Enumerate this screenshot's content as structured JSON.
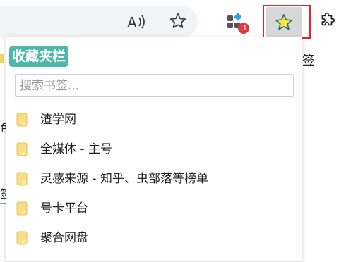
{
  "toolbar": {
    "read_aloud_icon": "read-aloud-icon",
    "favorite_icon": "star-outline-icon",
    "extensions_badge": "3",
    "collect_icon": "yellow-star-icon",
    "puzzle_icon": "puzzle-icon"
  },
  "background": {
    "left_char_1": "色",
    "left_char_2": "签",
    "right_text": "签"
  },
  "popup": {
    "title": "收藏夹栏",
    "search_placeholder": "搜索书签...",
    "items": [
      {
        "label": "渣学网"
      },
      {
        "label": "全媒体 - 主号"
      },
      {
        "label": "灵感来源 - 知乎、虫部落等榜单"
      },
      {
        "label": "号卡平台"
      },
      {
        "label": "聚合网盘"
      }
    ]
  },
  "colors": {
    "title_bg": "#4db8a8",
    "badge": "#e0383d",
    "highlight_border": "#e0262b",
    "folder": "#f2d36b"
  }
}
